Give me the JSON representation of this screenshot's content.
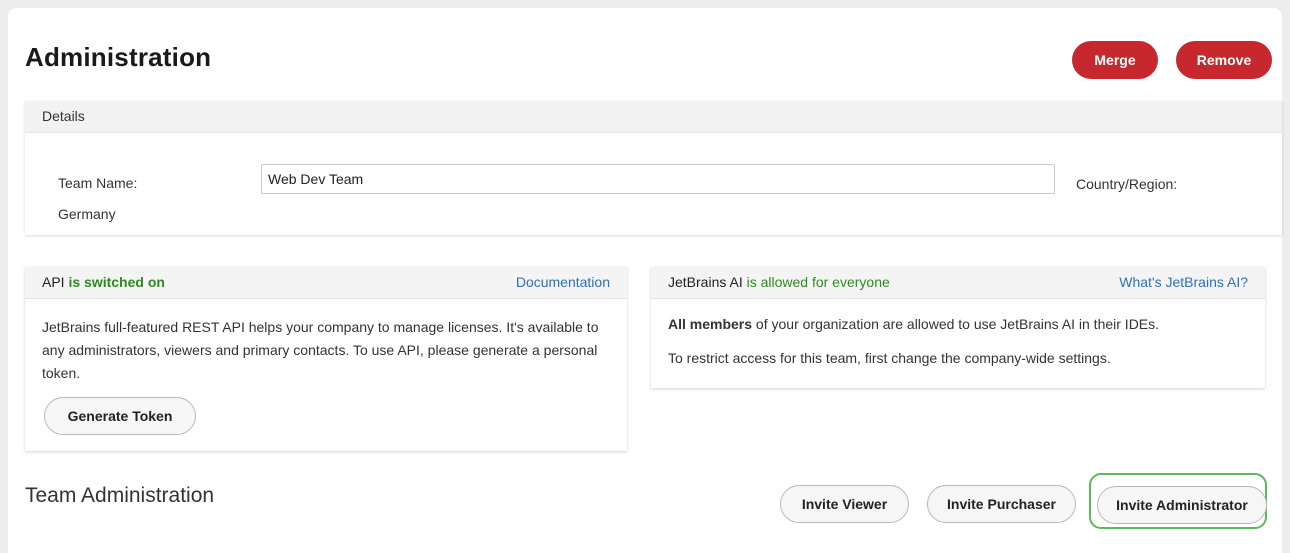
{
  "header": {
    "title": "Administration",
    "merge_label": "Merge",
    "remove_label": "Remove"
  },
  "details": {
    "section_label": "Details",
    "team_name_label": "Team Name:",
    "team_name_value": "Web Dev Team",
    "country_label": "Country/Region:",
    "country_value": "Germany"
  },
  "api": {
    "label": "API",
    "status": "is switched on",
    "doc_link": "Documentation",
    "description": "JetBrains full-featured REST API helps your company to manage licenses. It's available to any administrators, viewers and primary contacts. To use API, please generate a personal token.",
    "generate_token_label": "Generate Token"
  },
  "ai": {
    "label": "JetBrains AI",
    "status": "is allowed for everyone",
    "info_link": "What's JetBrains AI?",
    "members_bold": "All members",
    "members_rest": " of your organization are allowed to use JetBrains AI in their IDEs.",
    "restrict_note": "To restrict access for this team, first change the company-wide settings."
  },
  "team_admin": {
    "title": "Team Administration",
    "invite_viewer_label": "Invite Viewer",
    "invite_purchaser_label": "Invite Purchaser",
    "invite_admin_label": "Invite Administrator"
  },
  "colors": {
    "danger": "#c7282e",
    "success": "#2e8b1f",
    "link": "#2f6fc0",
    "focus": "#5cb85c"
  }
}
